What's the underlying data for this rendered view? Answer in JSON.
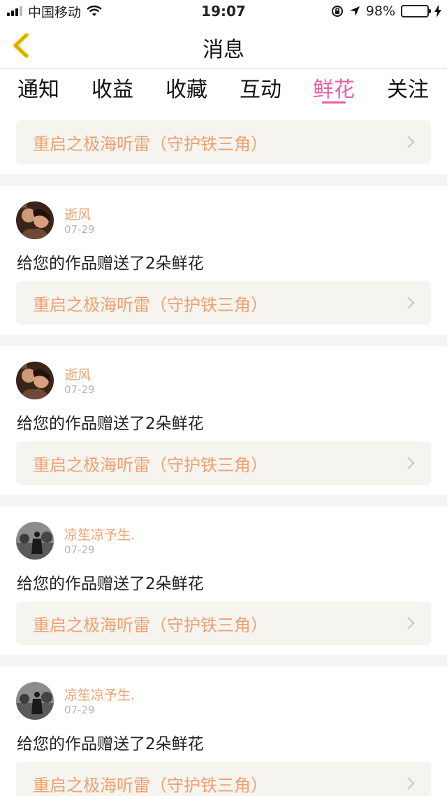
{
  "status_bar": {
    "carrier": "中国移动",
    "time": "19:07",
    "battery_percent": "98%",
    "battery_level": 0.98,
    "icons": [
      "signal-bars-icon",
      "wifi-icon",
      "orientation-lock-icon",
      "location-arrow-icon",
      "battery-icon",
      "charging-bolt-icon"
    ]
  },
  "nav": {
    "title": "消息",
    "back_icon": "chevron-left-icon",
    "back_color": "#f5c400"
  },
  "tabs": [
    {
      "label": "通知"
    },
    {
      "label": "收益"
    },
    {
      "label": "收藏"
    },
    {
      "label": "互动"
    },
    {
      "label": "鲜花",
      "active": true
    },
    {
      "label": "关注"
    }
  ],
  "colors": {
    "accent_pink": "#e560a0",
    "username_orange": "#f0a070",
    "work_link_bg": "#f5f4ee"
  },
  "first_item": {
    "work_title": "重启之极海听雷（守护铁三角）"
  },
  "messages": [
    {
      "username": "逝风",
      "date": "07-29",
      "text": "给您的作品赠送了2朵鲜花",
      "work_title": "重启之极海听雷（守护铁三角）"
    },
    {
      "username": "逝风",
      "date": "07-29",
      "text": "给您的作品赠送了2朵鲜花",
      "work_title": "重启之极海听雷（守护铁三角）"
    },
    {
      "username": "凉笙凉予生.",
      "date": "07-29",
      "text": "给您的作品赠送了2朵鲜花",
      "work_title": "重启之极海听雷（守护铁三角）"
    },
    {
      "username": "凉笙凉予生.",
      "date": "07-29",
      "text": "给您的作品赠送了2朵鲜花",
      "work_title": "重启之极海听雷（守护铁三角）"
    }
  ]
}
